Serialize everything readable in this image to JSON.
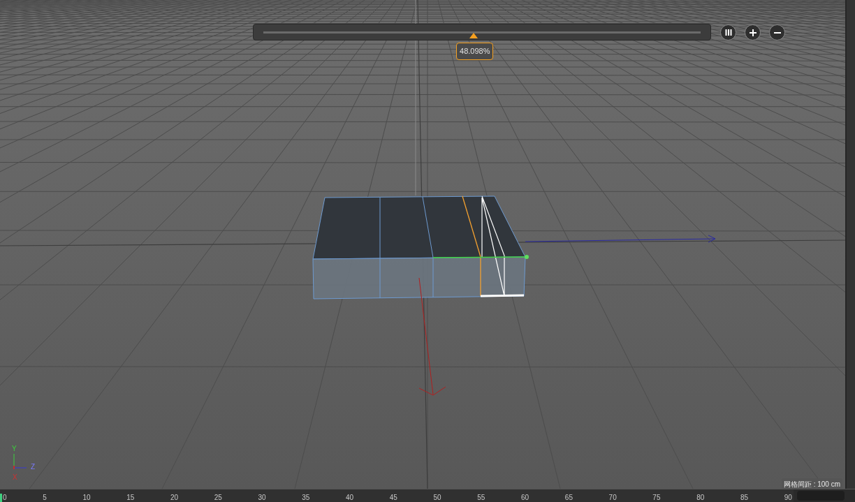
{
  "slider": {
    "level": 0.48098,
    "reading": "48.098%"
  },
  "view_buttons": [
    {
      "kind": "bars"
    },
    {
      "kind": "plus"
    },
    {
      "kind": "minus"
    }
  ],
  "axis_labels": {
    "y": "Y",
    "z": "Z",
    "x": "X"
  },
  "grid_spacing": "网格间距 : 100 cm",
  "timeline": {
    "ticks": [
      "0",
      "5",
      "10",
      "15",
      "20",
      "25",
      "30",
      "35",
      "40",
      "45",
      "50",
      "55",
      "60",
      "65",
      "70",
      "75",
      "80",
      "85",
      "90"
    ]
  }
}
